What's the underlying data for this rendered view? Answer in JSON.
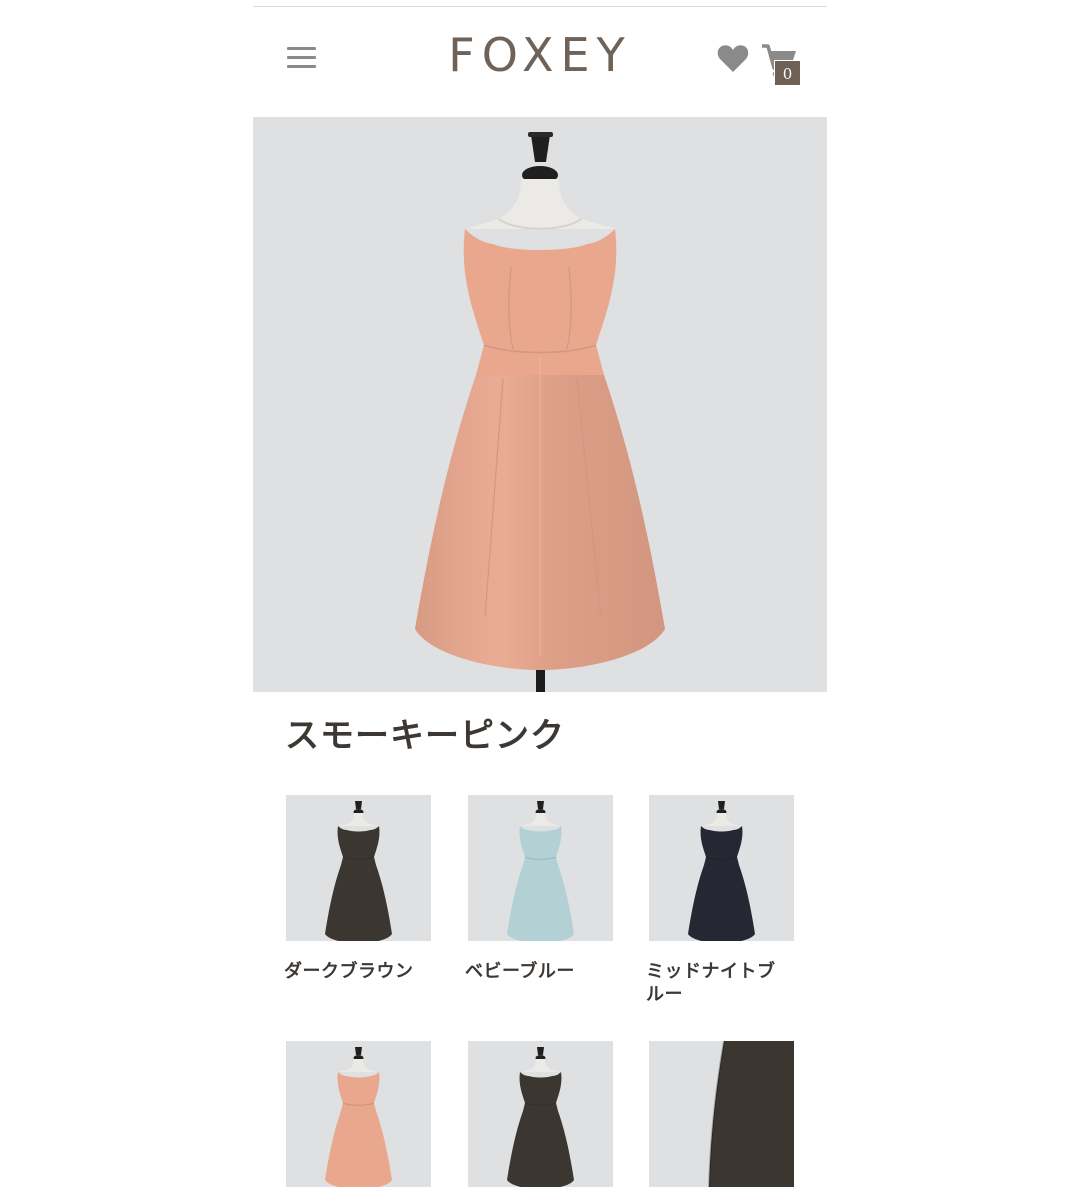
{
  "header": {
    "logo_text": "FOXEY",
    "menu_icon": "hamburger-menu-icon",
    "wishlist_icon": "heart-icon",
    "cart_icon": "shopping-cart-icon",
    "cart_count": "0"
  },
  "product": {
    "selected_color_name": "スモーキーピンク",
    "selected_color_hex": "#e9a78e"
  },
  "color_options": [
    {
      "label": "ダークブラウン",
      "dress_color": "#3b3630"
    },
    {
      "label": "ベビーブルー",
      "dress_color": "#b3d0d4"
    },
    {
      "label": "ミッドナイトブルー",
      "dress_color": "#252832"
    },
    {
      "label": "",
      "dress_color": "#e9a78e"
    },
    {
      "label": "",
      "dress_color": "#3b3630"
    },
    {
      "label": "",
      "dress_color": "#3b3630"
    }
  ],
  "colors": {
    "brand": "#6e6259",
    "image_background": "#dfe0e1",
    "text": "#3d3833"
  }
}
